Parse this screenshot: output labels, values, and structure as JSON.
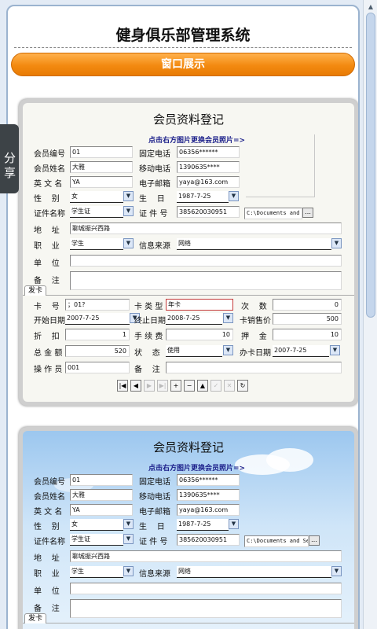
{
  "app": {
    "title": "健身俱乐部管理系统",
    "section": "窗口展示",
    "share": "分享"
  },
  "form": {
    "title": "会员资料登记",
    "photo_hint": "点击右方图片更换会员照片=>",
    "labels": {
      "member_id": "会员编号",
      "name": "会员姓名",
      "english_name": "英 文 名",
      "gender": "性    别",
      "id_type": "证件名称",
      "address": "地    址",
      "job": "职    业",
      "company": "单    位",
      "remarks": "备    注",
      "phone": "固定电话",
      "mobile": "移动电话",
      "email": "电子邮箱",
      "birthday": "生    日",
      "id_no": "证 件 号",
      "source": "信息来源"
    },
    "values": {
      "member_id": "01",
      "name": "大雅",
      "english_name": "YA",
      "gender": "女",
      "id_type": "学生证",
      "address": "聊城振兴西路",
      "job": "学生",
      "company": "",
      "remarks": "",
      "phone": "06356******",
      "mobile": "1390635****",
      "email": "yaya@163.com",
      "birthday": "1987-7-25",
      "id_no": "385620030951",
      "source": "网络",
      "photo_path": "C:\\Documents and",
      "photo_path2": "C:\\Documents and Se"
    },
    "card_tab": "发卡",
    "card": {
      "labels": {
        "card_no": "卡    号",
        "card_type": "卡 类 型",
        "times": "次    数",
        "start_date": "开始日期",
        "end_date": "终止日期",
        "price": "卡销售价",
        "discount": "折    扣",
        "fee": "手 续 费",
        "deposit": "押    金",
        "total": "总 金 额",
        "status": "状    态",
        "issue_date": "办卡日期",
        "operator": "操 作 员",
        "remark": "备    注"
      },
      "values": {
        "card_no": "；01?",
        "card_type": "年卡",
        "times": "0",
        "start_date": "2007-7-25",
        "end_date": "2008-7-25",
        "price": "500",
        "discount": "1",
        "fee": "10",
        "deposit": "10",
        "total": "520",
        "status": "使用",
        "issue_date": "2007-7-25",
        "operator": "001",
        "remark": ""
      }
    },
    "nav_buttons": [
      {
        "name": "first-record-button",
        "glyph": "|◀"
      },
      {
        "name": "prev-record-button",
        "glyph": "◀"
      },
      {
        "name": "next-record-button",
        "glyph": "▶"
      },
      {
        "name": "last-record-button",
        "glyph": "▶|"
      },
      {
        "name": "add-record-button",
        "glyph": "+"
      },
      {
        "name": "delete-record-button",
        "glyph": "−"
      },
      {
        "name": "edit-record-button",
        "glyph": "▲"
      },
      {
        "name": "post-record-button",
        "glyph": "✓"
      },
      {
        "name": "cancel-record-button",
        "glyph": "✕"
      },
      {
        "name": "refresh-record-button",
        "glyph": "↻"
      }
    ]
  },
  "colors": {
    "orange": "#f38a10",
    "hint": "#1b1f8a",
    "frame": "#9bb3cf"
  }
}
